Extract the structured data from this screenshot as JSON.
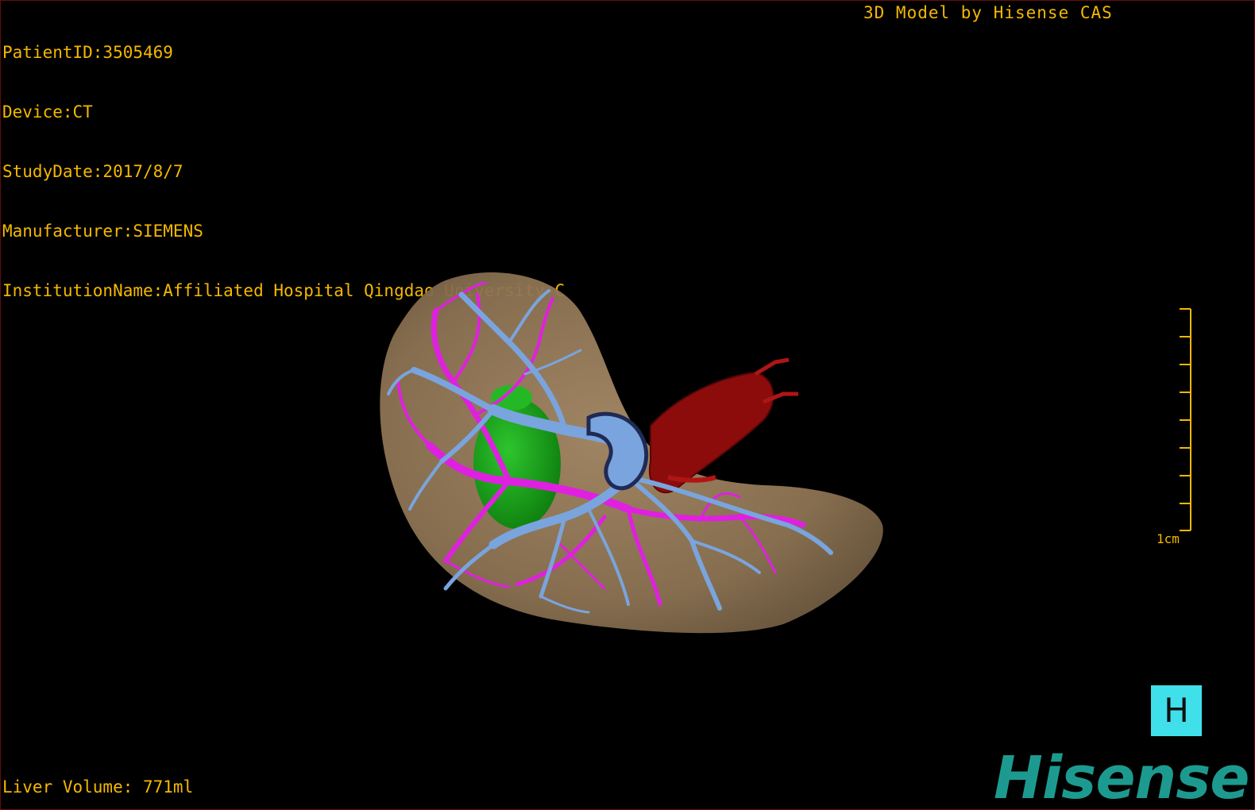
{
  "overlay": {
    "patient_id": "PatientID:3505469",
    "device": "Device:CT",
    "study_date": "StudyDate:2017/8/7",
    "manufacturer": "Manufacturer:SIEMENS",
    "institution": "InstitutionName:Affiliated Hospital Qingdao University-C",
    "brand_title": "3D Model by Hisense CAS",
    "liver_volume": "Liver Volume: 771ml"
  },
  "scale_bar": {
    "label": "1cm"
  },
  "view_button": {
    "label": "H"
  },
  "logo": {
    "text": "Hisense"
  },
  "colors": {
    "text": "#f5b800",
    "liver": "#9a7e5c",
    "portal_vein": "#e020e0",
    "hepatic_vein": "#7aa4dd",
    "tumor": "#1aa31a",
    "vena_cava": "#8c0c0c",
    "button": "#3fe0ea",
    "logo": "#1d9a8f"
  }
}
